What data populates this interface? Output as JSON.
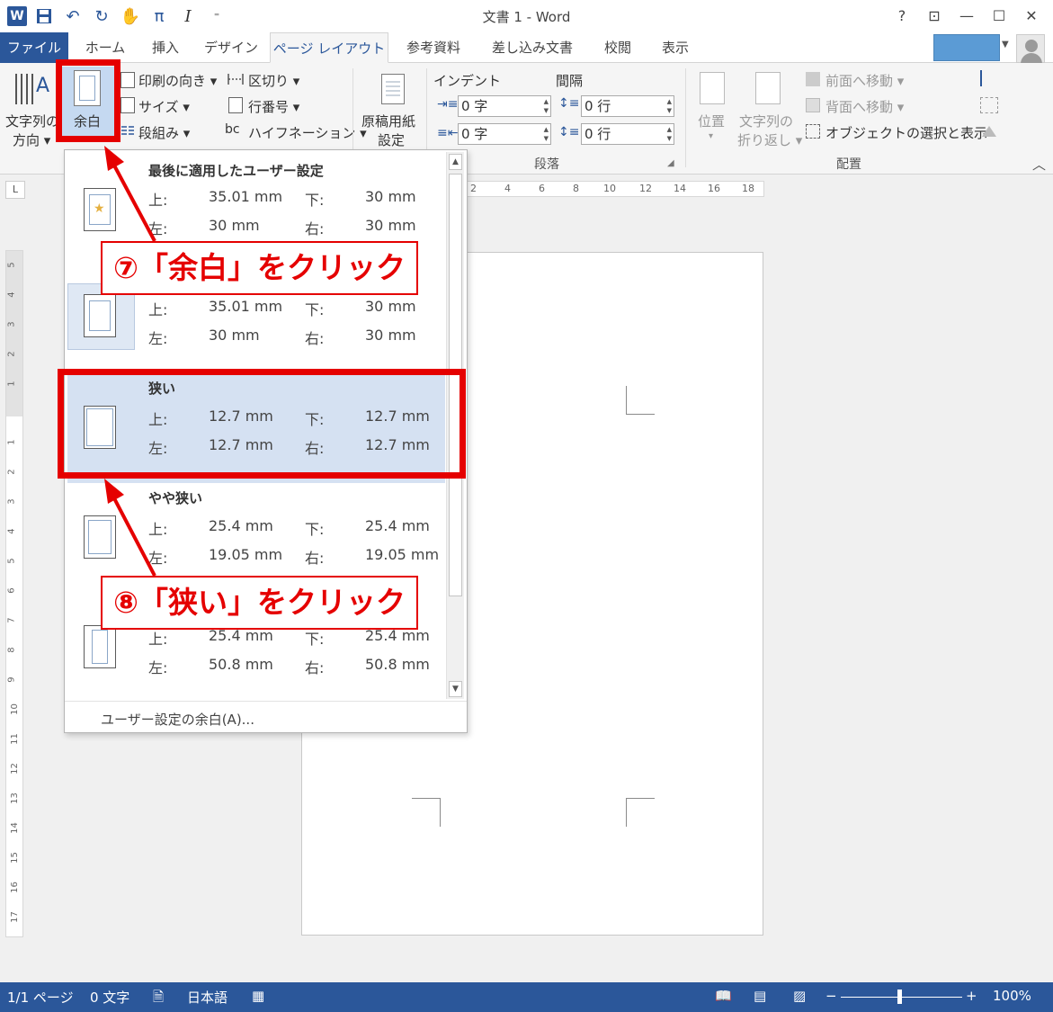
{
  "window": {
    "title": "文書 1 - Word",
    "help": "?",
    "ribbon_display": "⊡",
    "minimize": "—",
    "maximize": "☐",
    "close": "✕"
  },
  "qat": {
    "app_icon": "W",
    "save": "💾",
    "undo": "↶",
    "redo": "↻",
    "touch": "✋",
    "equation": "π",
    "italic": "I",
    "customize": "⁼"
  },
  "tabs": [
    "ファイル",
    "ホーム",
    "挿入",
    "デザイン",
    "ページ レイアウト",
    "参考資料",
    "差し込み文書",
    "校閲",
    "表示"
  ],
  "ribbon": {
    "text_direction": [
      "文字列の",
      "方向 ▾"
    ],
    "margins": "余白",
    "orientation": "印刷の向き ▾",
    "size": "サイズ ▾",
    "columns": "段組み ▾",
    "breaks": "区切り ▾",
    "line_numbers": "行番号 ▾",
    "hyphenation": "ハイフネーション ▾",
    "manuscript": [
      "原稿用紙",
      "設定"
    ],
    "indent_label": "インデント",
    "spacing_label": "間隔",
    "indent_left": "0 字",
    "indent_right": "0 字",
    "spacing_before": "0 行",
    "spacing_after": "0 行",
    "paragraph_group": "段落",
    "position": "位置",
    "wrap_text": [
      "文字列の",
      "折り返し ▾"
    ],
    "bring_forward": "前面へ移動 ▾",
    "send_backward": "背面へ移動 ▾",
    "selection_pane": "オブジェクトの選択と表示",
    "arrange_group": "配置"
  },
  "ruler": {
    "h_ticks": [
      "2",
      "4",
      "6",
      "8",
      "10",
      "12",
      "14",
      "16",
      "18"
    ],
    "v_ticks": [
      "5",
      "4",
      "3",
      "2",
      "1",
      "1",
      "2",
      "3",
      "4",
      "5",
      "6",
      "7",
      "8",
      "9",
      "10",
      "11",
      "12",
      "13",
      "14",
      "15",
      "16",
      "17"
    ],
    "corner": "L"
  },
  "margins_menu": {
    "items": [
      {
        "title": "最後に適用したユーザー設定",
        "top_label": "上:",
        "top": "35.01 mm",
        "bottom_label": "下:",
        "bottom": "30 mm",
        "left_label": "左:",
        "left": "30 mm",
        "right_label": "右:",
        "right": "30 mm"
      },
      {
        "title": "",
        "top_label": "上:",
        "top": "35.01 mm",
        "bottom_label": "下:",
        "bottom": "30 mm",
        "left_label": "左:",
        "left": "30 mm",
        "right_label": "右:",
        "right": "30 mm"
      },
      {
        "title": "狭い",
        "top_label": "上:",
        "top": "12.7 mm",
        "bottom_label": "下:",
        "bottom": "12.7 mm",
        "left_label": "左:",
        "left": "12.7 mm",
        "right_label": "右:",
        "right": "12.7 mm"
      },
      {
        "title": "やや狭い",
        "top_label": "上:",
        "top": "25.4 mm",
        "bottom_label": "下:",
        "bottom": "25.4 mm",
        "left_label": "左:",
        "left": "19.05 mm",
        "right_label": "右:",
        "right": "19.05 mm"
      },
      {
        "title": "",
        "top_label": "上:",
        "top": "25.4 mm",
        "bottom_label": "下:",
        "bottom": "25.4 mm",
        "left_label": "左:",
        "left": "50.8 mm",
        "right_label": "右:",
        "right": "50.8 mm"
      }
    ],
    "custom": "ユーザー設定の余白(A)..."
  },
  "annotations": {
    "step7": "⑦「余白」をクリック",
    "step8": "⑧「狭い」をクリック"
  },
  "status": {
    "page": "1/1 ページ",
    "words": "0 文字",
    "language": "日本語",
    "zoom": "100%",
    "zoom_minus": "−",
    "zoom_plus": "+"
  },
  "colors": {
    "accent": "#2b579a",
    "annotation": "#e50000",
    "hover": "#d5e1f2"
  }
}
